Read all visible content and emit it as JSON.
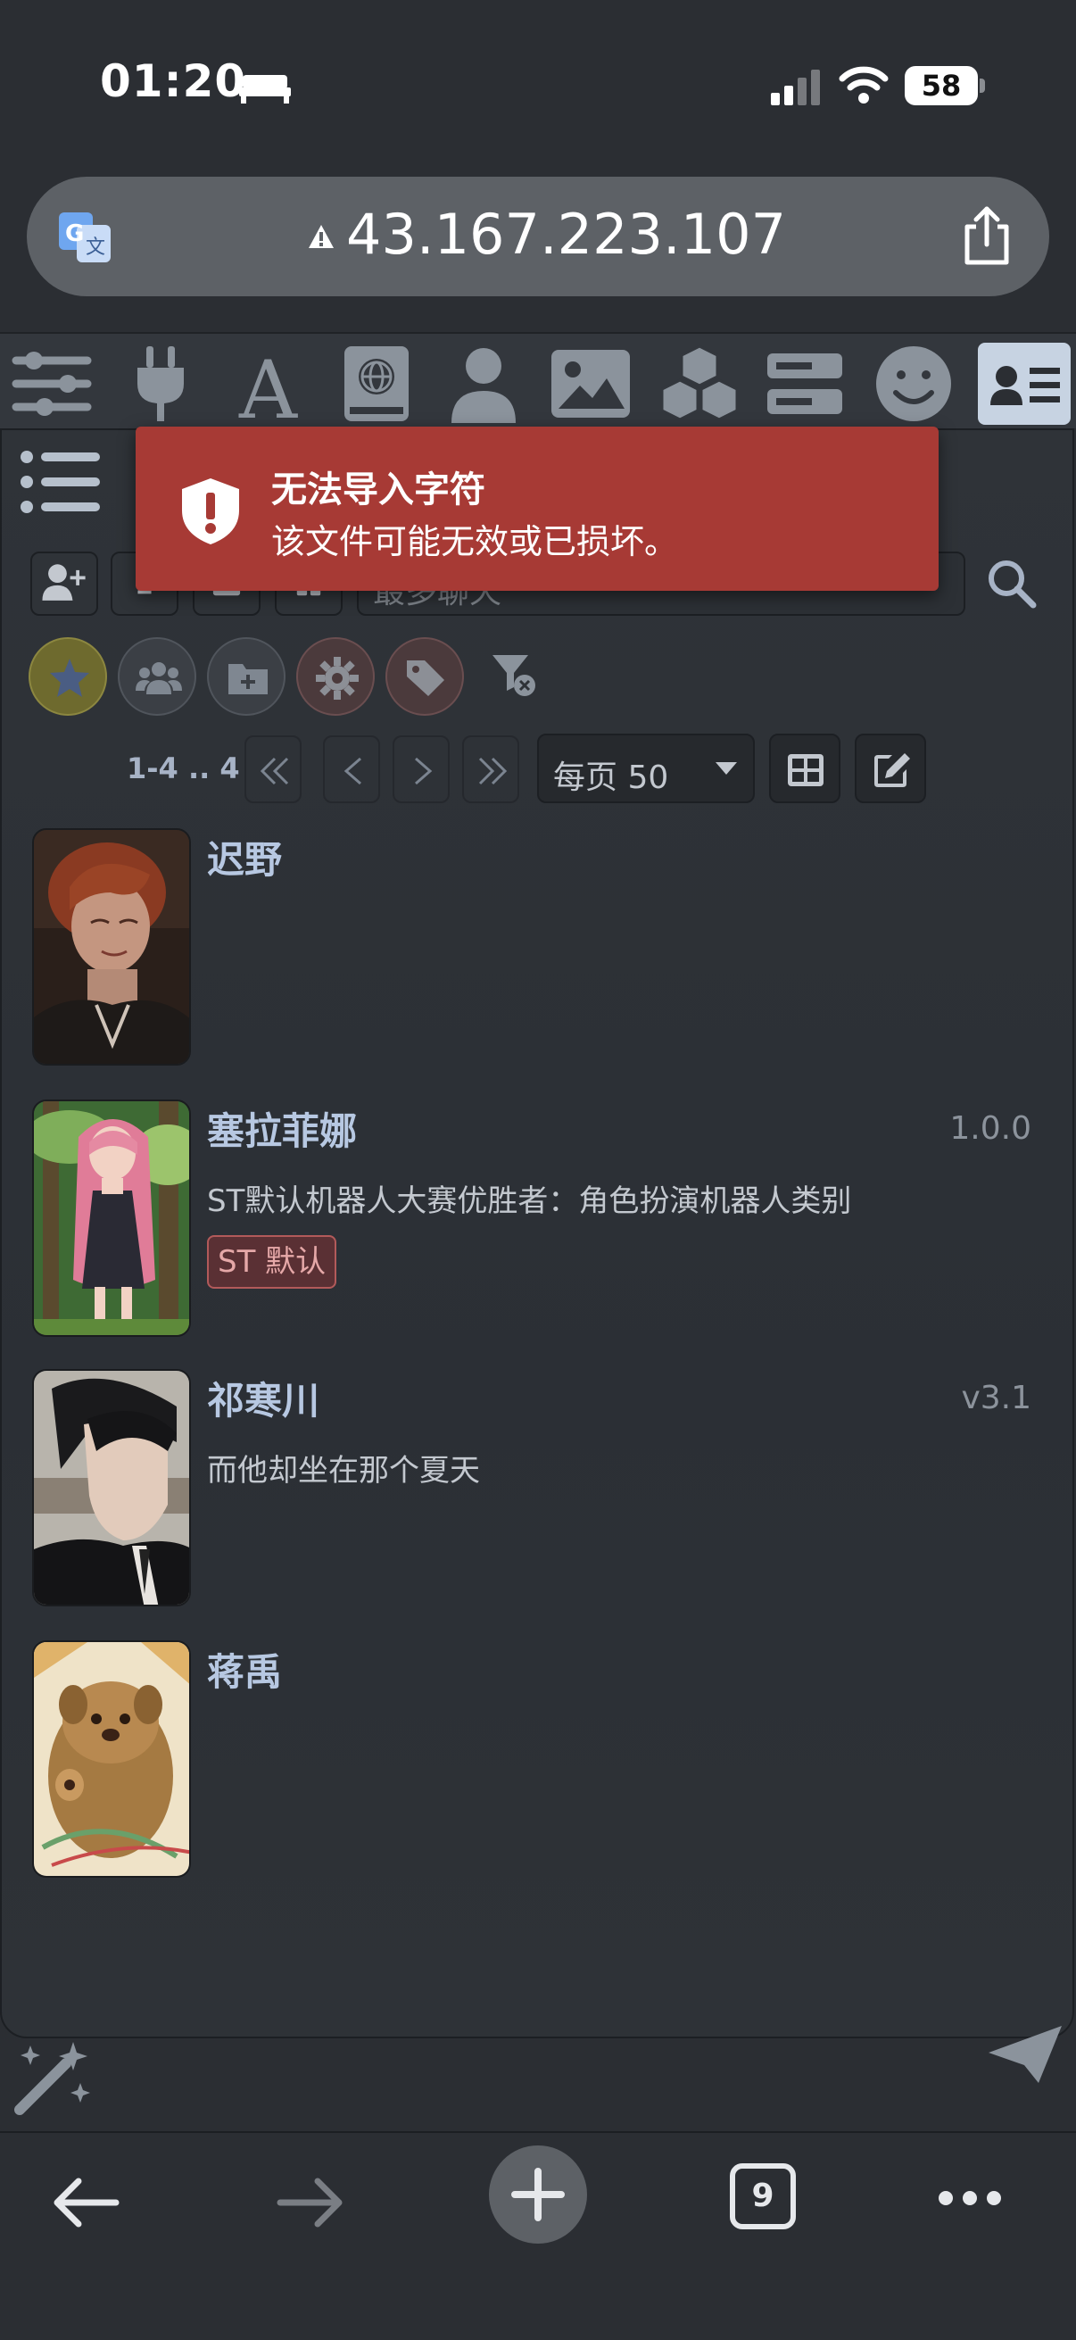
{
  "status_bar": {
    "time": "01:20",
    "battery": "58"
  },
  "url_bar": {
    "url": "43.167.223.107"
  },
  "nav": {
    "icons": [
      "sliders-icon",
      "plug-icon",
      "font-icon",
      "book-globe-icon",
      "user-icon",
      "image-icon",
      "cubes-icon",
      "server-icon",
      "smiley-icon",
      "id-card-icon"
    ],
    "active": "id-card-icon"
  },
  "toast": {
    "title": "无法导入字符",
    "message": "该文件可能无效或已损坏。"
  },
  "search": {
    "placeholder": "最多聊天"
  },
  "pagination": {
    "range": "1-4 .. 4",
    "per_page": "每页 50"
  },
  "characters": [
    {
      "name": "迟野",
      "version": "",
      "description": "",
      "tag": ""
    },
    {
      "name": "塞拉菲娜",
      "version": "1.0.0",
      "description": "ST默认机器人大赛优胜者：角色扮演机器人类别",
      "tag": "ST 默认"
    },
    {
      "name": "祁寒川",
      "version": "v3.1",
      "description": "而他却坐在那个夏天",
      "tag": ""
    },
    {
      "name": "蒋禹",
      "version": "",
      "description": "",
      "tag": ""
    }
  ],
  "browser": {
    "tab_count": "9"
  },
  "colors": {
    "toast_bg": "#a73a35",
    "accent_name": "#b7c8e2",
    "tag_border": "#b25a5a",
    "active_nav": "#c7d3e2"
  }
}
